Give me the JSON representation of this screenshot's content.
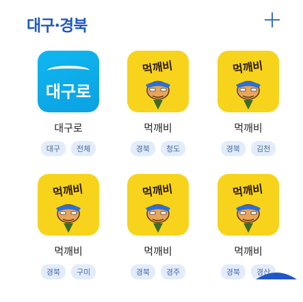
{
  "header": {
    "title": "대구·경북"
  },
  "apps": [
    {
      "name": "대구로",
      "icon": "daeguro",
      "tags": [
        "대구",
        "전체"
      ]
    },
    {
      "name": "먹깨비",
      "icon": "mukkaebi",
      "tags": [
        "경북",
        "청도"
      ]
    },
    {
      "name": "먹깨비",
      "icon": "mukkaebi",
      "tags": [
        "경북",
        "김천"
      ]
    },
    {
      "name": "먹깨비",
      "icon": "mukkaebi",
      "tags": [
        "경북",
        "구미"
      ]
    },
    {
      "name": "먹깨비",
      "icon": "mukkaebi",
      "tags": [
        "경북",
        "경주"
      ]
    },
    {
      "name": "먹깨비",
      "icon": "mukkaebi",
      "tags": [
        "경북",
        "경산"
      ]
    }
  ],
  "icons": {
    "add": "plus-icon",
    "daeguro_logo_text": "대구로",
    "mukkaebi_logo_text": "먹깨비"
  },
  "colors": {
    "title": "#1f57c3",
    "tag_bg": "#e3ecfb",
    "tag_text": "#4369a6",
    "daeguro_bg": "#10b7ef",
    "mukkaebi_bg": "#f7d31b"
  }
}
